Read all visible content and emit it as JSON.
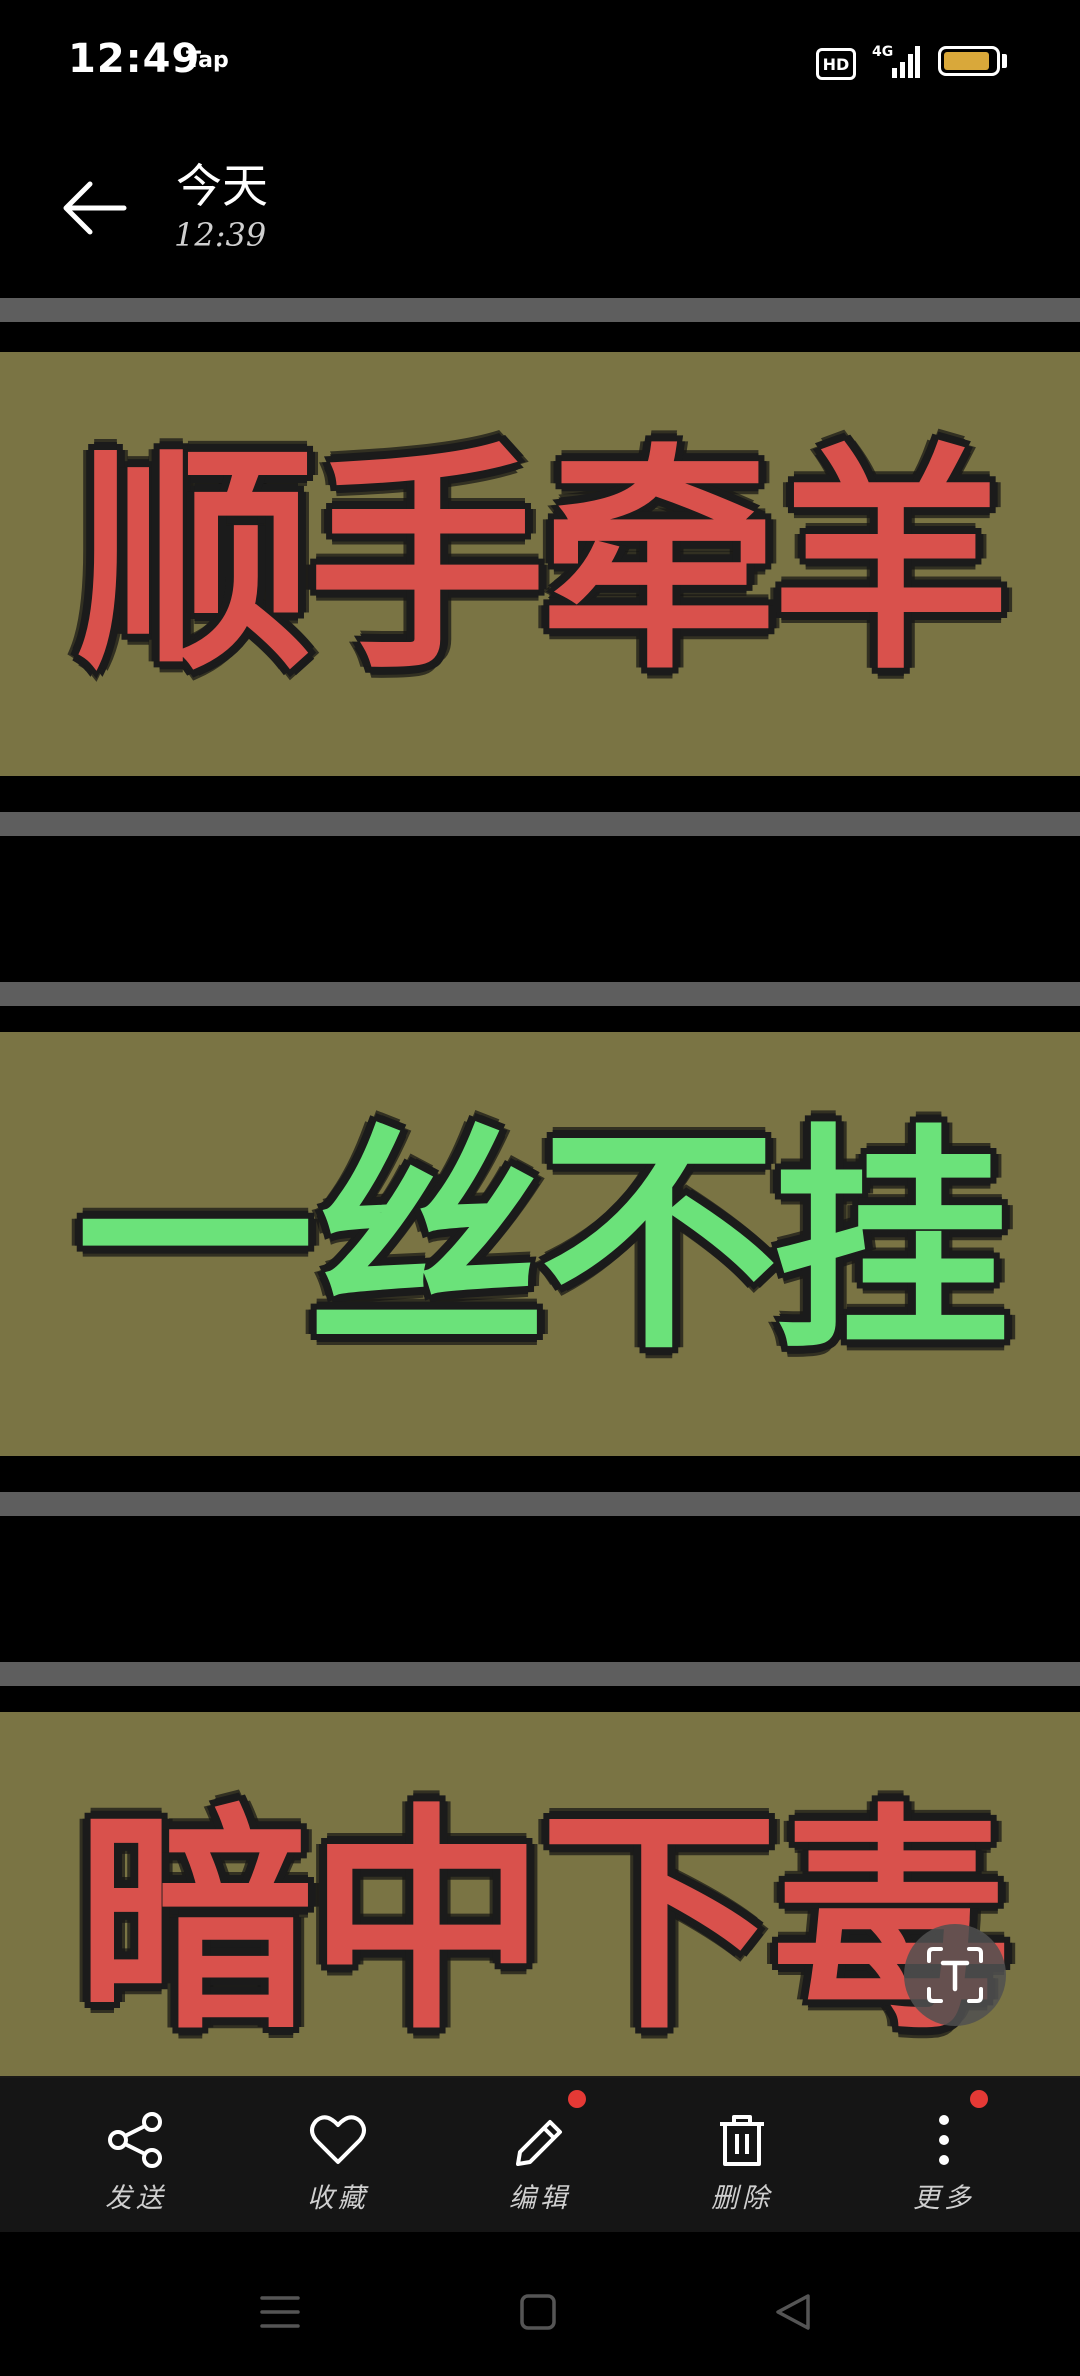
{
  "status_bar": {
    "time": "12:49",
    "app_indicator": "Tap",
    "hd_badge": "HD",
    "network": "4G",
    "battery_level": 0.9,
    "battery_color": "#d9a83a"
  },
  "header": {
    "title": "今天",
    "time": "12:39"
  },
  "image": {
    "panels": [
      {
        "text": "顺手牵羊",
        "color": "#d9514c"
      },
      {
        "text": "一丝不挂",
        "color": "#6be27a"
      },
      {
        "text": "暗中下毒",
        "color": "#d9514c"
      }
    ],
    "panel_background": "#7a7444"
  },
  "toolbar": {
    "items": [
      {
        "label": "发送",
        "icon": "share-icon",
        "badge": false
      },
      {
        "label": "收藏",
        "icon": "heart-icon",
        "badge": false
      },
      {
        "label": "编辑",
        "icon": "pencil-icon",
        "badge": true
      },
      {
        "label": "删除",
        "icon": "trash-icon",
        "badge": false
      },
      {
        "label": "更多",
        "icon": "more-icon",
        "badge": true
      }
    ],
    "badge_color": "#e53935"
  },
  "nav_bar": {
    "icons": [
      "menu-icon",
      "home-icon",
      "back-triangle-icon"
    ]
  }
}
